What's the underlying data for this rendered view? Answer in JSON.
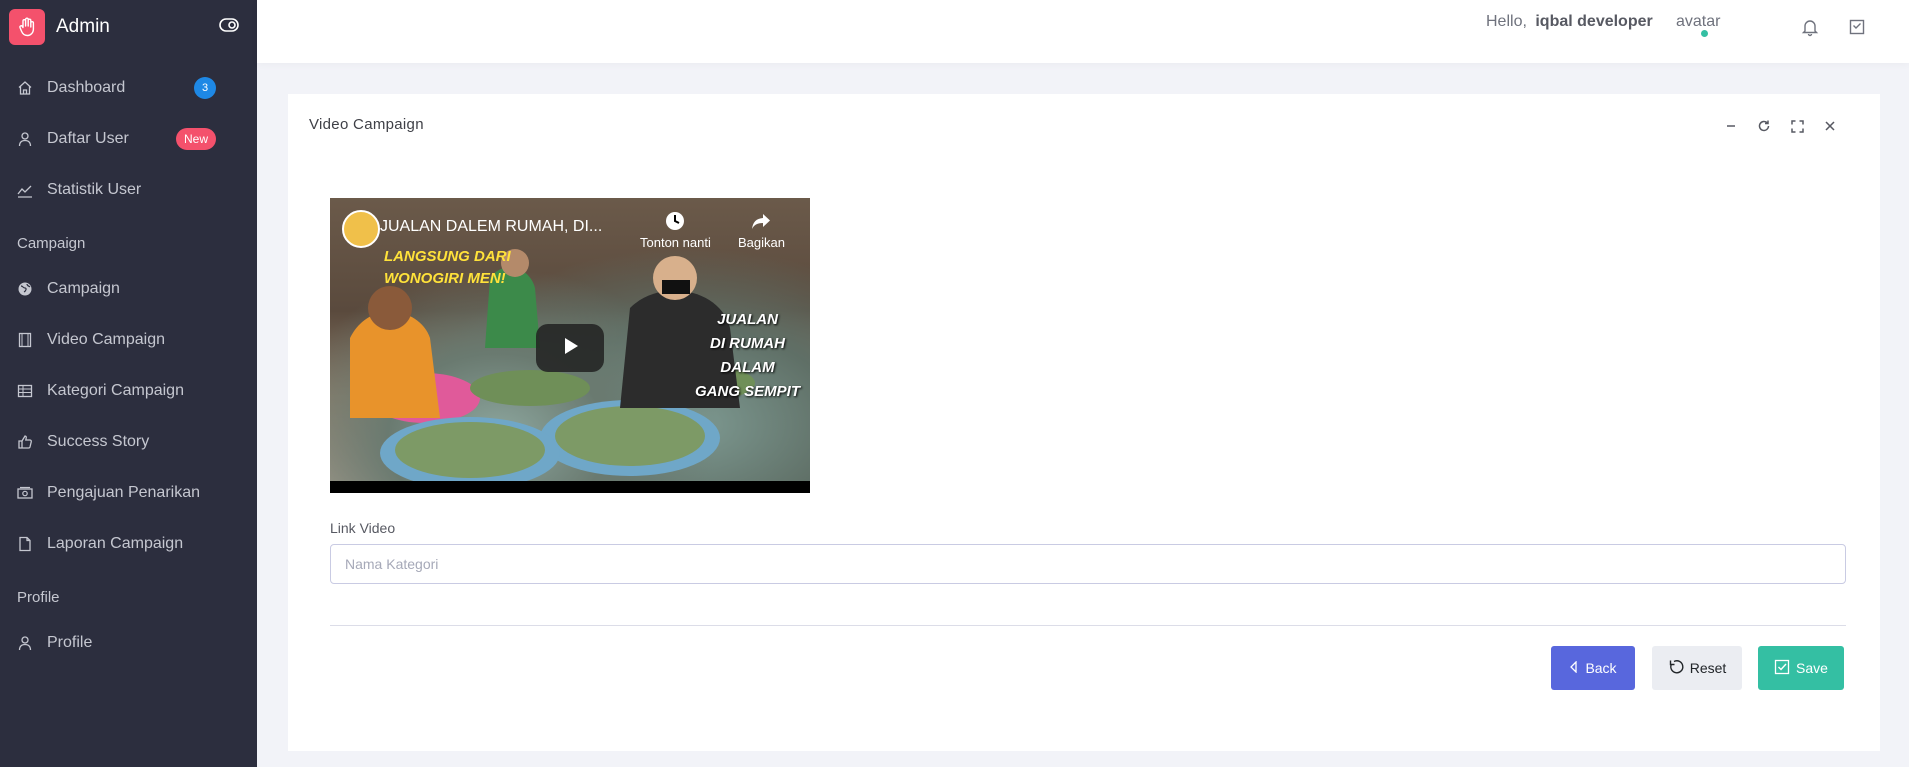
{
  "brand": {
    "title": "Admin",
    "accent": "#f4516c"
  },
  "sidebar": {
    "items": [
      {
        "label": "Dashboard",
        "icon": "home-icon",
        "badge": "3"
      },
      {
        "label": "Daftar User",
        "icon": "user-icon",
        "badge": "New"
      },
      {
        "label": "Statistik User",
        "icon": "chart-line-icon"
      }
    ],
    "sections": [
      {
        "title": "Campaign",
        "items": [
          {
            "label": "Campaign",
            "icon": "globe-icon"
          },
          {
            "label": "Video Campaign",
            "icon": "film-icon"
          },
          {
            "label": "Kategori Campaign",
            "icon": "table-icon"
          },
          {
            "label": "Success Story",
            "icon": "thumbs-up-icon"
          },
          {
            "label": "Pengajuan Penarikan",
            "icon": "money-icon"
          },
          {
            "label": "Laporan Campaign",
            "icon": "file-icon"
          }
        ]
      },
      {
        "title": "Profile",
        "items": [
          {
            "label": "Profile",
            "icon": "user-icon"
          }
        ]
      }
    ]
  },
  "topbar": {
    "greeting": "Hello,",
    "username": "iqbal developer",
    "avatar_alt": "avatar"
  },
  "card": {
    "title": "Video Campaign"
  },
  "video": {
    "title": "JUALAN DALEM RUMAH, DI...",
    "watch_later": "Tonton nanti",
    "share": "Bagikan",
    "overlay_yellow": [
      "LANGSUNG DARI",
      "WONOGIRI MEN!"
    ],
    "overlay_white": [
      "JUALAN",
      "DI RUMAH",
      "DALAM",
      "GANG SEMPIT"
    ]
  },
  "form": {
    "link_label": "Link Video",
    "link_placeholder": "Nama Kategori",
    "link_value": ""
  },
  "buttons": {
    "back": "Back",
    "reset": "Reset",
    "save": "Save"
  },
  "colors": {
    "sidebar_bg": "#2c2e3e",
    "primary": "#5867dd",
    "success": "#34bfa3",
    "info": "#1e88e5",
    "danger": "#f4516c"
  }
}
